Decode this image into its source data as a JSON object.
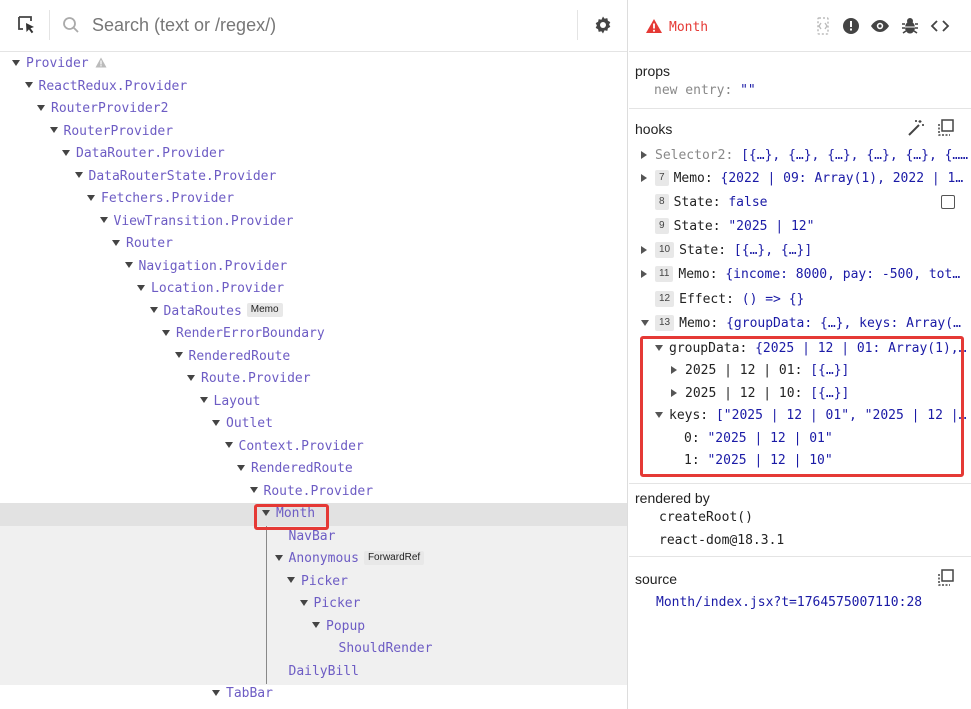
{
  "toolbar": {
    "search_placeholder": "Search (text or /regex/)"
  },
  "tree": [
    {
      "label": "Provider",
      "badge": "",
      "warn": true
    },
    {
      "label": "ReactRedux.Provider",
      "badge": ""
    },
    {
      "label": "RouterProvider2",
      "badge": ""
    },
    {
      "label": "RouterProvider",
      "badge": ""
    },
    {
      "label": "DataRouter.Provider",
      "badge": ""
    },
    {
      "label": "DataRouterState.Provider",
      "badge": ""
    },
    {
      "label": "Fetchers.Provider",
      "badge": ""
    },
    {
      "label": "ViewTransition.Provider",
      "badge": ""
    },
    {
      "label": "Router",
      "badge": ""
    },
    {
      "label": "Navigation.Provider",
      "badge": ""
    },
    {
      "label": "Location.Provider",
      "badge": ""
    },
    {
      "label": "DataRoutes",
      "badge": "Memo"
    },
    {
      "label": "RenderErrorBoundary",
      "badge": ""
    },
    {
      "label": "RenderedRoute",
      "badge": ""
    },
    {
      "label": "Route.Provider",
      "badge": ""
    },
    {
      "label": "Layout",
      "badge": ""
    },
    {
      "label": "Outlet",
      "badge": ""
    },
    {
      "label": "Context.Provider",
      "badge": ""
    },
    {
      "label": "RenderedRoute",
      "badge": ""
    },
    {
      "label": "Route.Provider",
      "badge": ""
    },
    {
      "label": "Month",
      "badge": ""
    },
    {
      "label": "NavBar",
      "badge": ""
    },
    {
      "label": "Anonymous",
      "badge": "ForwardRef"
    },
    {
      "label": "Picker",
      "badge": ""
    },
    {
      "label": "Picker",
      "badge": ""
    },
    {
      "label": "Popup",
      "badge": ""
    },
    {
      "label": "ShouldRender",
      "badge": ""
    },
    {
      "label": "DailyBill",
      "badge": ""
    },
    {
      "label": "TabBar",
      "badge": ""
    }
  ],
  "inspector": {
    "component_name": "Month",
    "props": {
      "title": "props",
      "new_entry_key": "new entry:",
      "new_entry_value": "\"\""
    },
    "hooks": {
      "title": "hooks",
      "items": [
        {
          "index": "",
          "name": "Selector2:",
          "value": "[{…}, {…}, {…}, {…}, {…}, {……"
        },
        {
          "index": "7",
          "name": "Memo:",
          "value": "{2022 | 09: Array(1), 2022 | 1…"
        },
        {
          "index": "8",
          "name": "State:",
          "value": "false"
        },
        {
          "index": "9",
          "name": "State:",
          "value": "\"2025 | 12\""
        },
        {
          "index": "10",
          "name": "State:",
          "value": "[{…}, {…}]"
        },
        {
          "index": "11",
          "name": "Memo:",
          "value": "{income: 8000, pay: -500, tot…"
        },
        {
          "index": "12",
          "name": "Effect:",
          "value": "() => {}"
        },
        {
          "index": "13",
          "name": "Memo:",
          "value": "{groupData: {…}, keys: Array(…"
        }
      ],
      "expanded": [
        {
          "name": "groupData:",
          "value": "{2025 | 12 | 01: Array(1),…"
        },
        {
          "name": "2025 | 12 | 01:",
          "value": "[{…}]"
        },
        {
          "name": "2025 | 12 | 10:",
          "value": "[{…}]"
        },
        {
          "name": "keys:",
          "value": "[\"2025 | 12 | 01\", \"2025 | 12 |…"
        },
        {
          "name": "0:",
          "value": "\"2025 | 12 | 01\""
        },
        {
          "name": "1:",
          "value": "\"2025 | 12 | 10\""
        }
      ]
    },
    "rendered_by": {
      "title": "rendered by",
      "items": [
        "createRoot()",
        "react-dom@18.3.1"
      ]
    },
    "source": {
      "title": "source",
      "link": "Month/index.jsx?t=1764575007110:28"
    }
  },
  "colors": {
    "accent_red": "#e53935",
    "tree_text": "#6d5cc4",
    "value_blue": "#1a1aa6",
    "selected_bg": "#e2e2e2"
  }
}
